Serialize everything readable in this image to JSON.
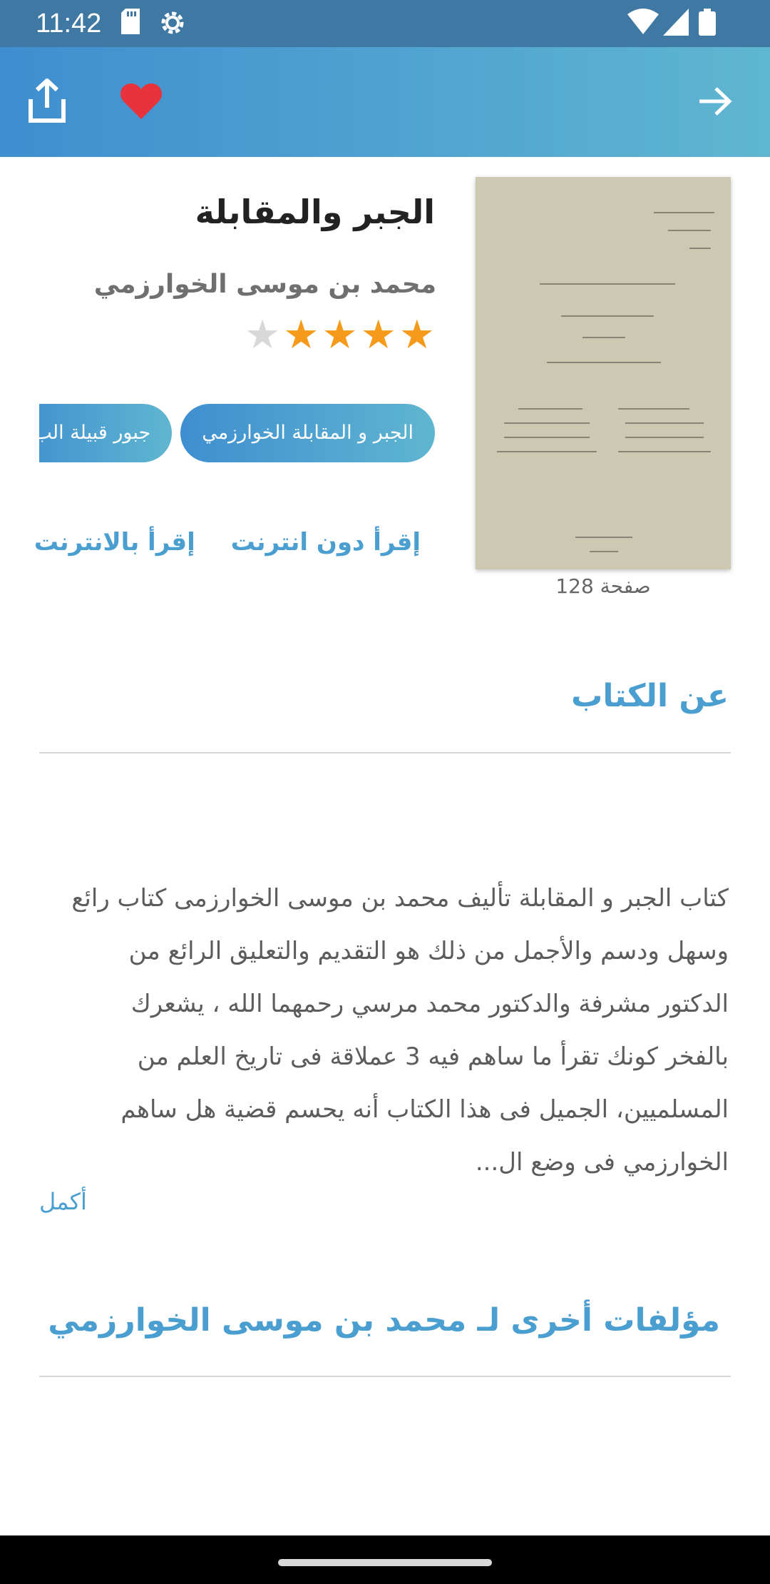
{
  "status_bar": {
    "time": "11:42"
  },
  "book": {
    "title": "الجبر والمقابلة",
    "author": "محمد بن موسى الخوارزمي",
    "rating": 4,
    "rating_max": 5,
    "pages": "128 صفحة",
    "tags": [
      "الجبر و المقابلة الخوارزمي",
      "جبور قبيلة الب"
    ],
    "read_offline": "إقرأ دون انترنت",
    "read_online": "إقرأ بالانترنت"
  },
  "about": {
    "heading": "عن الكتاب",
    "description": "كتاب الجبر و المقابلة تأليف محمد بن موسى الخوارزمى كتاب رائع وسهل ودسم والأجمل من ذلك هو التقديم والتعليق الرائع من الدكتور مشرفة والدكتور محمد مرسي رحمهما الله ، يشعرك بالفخر كونك تقرأ ما ساهم فيه 3 عملاقة فى تاريخ العلم من المسلميين، الجميل فى هذا الكتاب أنه يحسم قضية هل ساهم الخوارزمي فى وضع ال...",
    "more_label": "أكمل"
  },
  "other_works": {
    "heading": "مؤلفات أخرى لـ محمد بن موسى الخوارزمي"
  },
  "colors": {
    "accent": "#4a9ed0",
    "star_on": "#f59a1b",
    "star_off": "#d8d8d8",
    "heart": "#e8323c"
  }
}
